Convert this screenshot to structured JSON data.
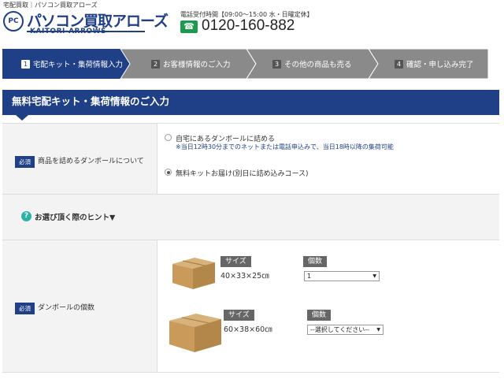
{
  "breadcrumb": "宅配買取｜パソコン買取アローズ",
  "logo": {
    "badge": "PC",
    "name_jp": "パソコン買取アローズ",
    "name_en": "KAITORI-ARROWS"
  },
  "contact": {
    "hours": "電話受付時間【09:00～15:00 水・日曜定休】",
    "phone_icon": "telephone-icon",
    "phone": "0120-160-882"
  },
  "steps": [
    {
      "num": "1",
      "label": "宅配キット・集荷情報入力",
      "active": true
    },
    {
      "num": "2",
      "label": "お客様情報のご入力",
      "active": false
    },
    {
      "num": "3",
      "label": "その他の商品も売る",
      "active": false
    },
    {
      "num": "4",
      "label": "確認・申し込み完了",
      "active": false
    }
  ],
  "section_title": "無料宅配キット・集荷情報のご入力",
  "required_label": "必須",
  "box_question": {
    "label": "商品を詰めるダンボールについて",
    "option1": "自宅にあるダンボールに詰める",
    "option1_note": "※当日12時30分までのネットまたは電話申込みで、当日18時以降の集荷可能",
    "option2": "無料キットお届け(別日に詰め込みコース)"
  },
  "hint": {
    "icon": "question-icon",
    "text": "お選び頂く際のヒント▼"
  },
  "box_count": {
    "label": "ダンボールの個数",
    "size_tag": "サイズ",
    "count_tag": "個数",
    "box1_size": "40×33×25㎝",
    "box1_value": "1",
    "box2_size": "60×38×60㎝",
    "box2_value": "--選択してください--"
  },
  "colors": {
    "brand": "#1f3f87",
    "step_inactive": "#8a8a8a",
    "hint_icon": "#2bb3a6",
    "phone_icon": "#1e9a4f"
  }
}
